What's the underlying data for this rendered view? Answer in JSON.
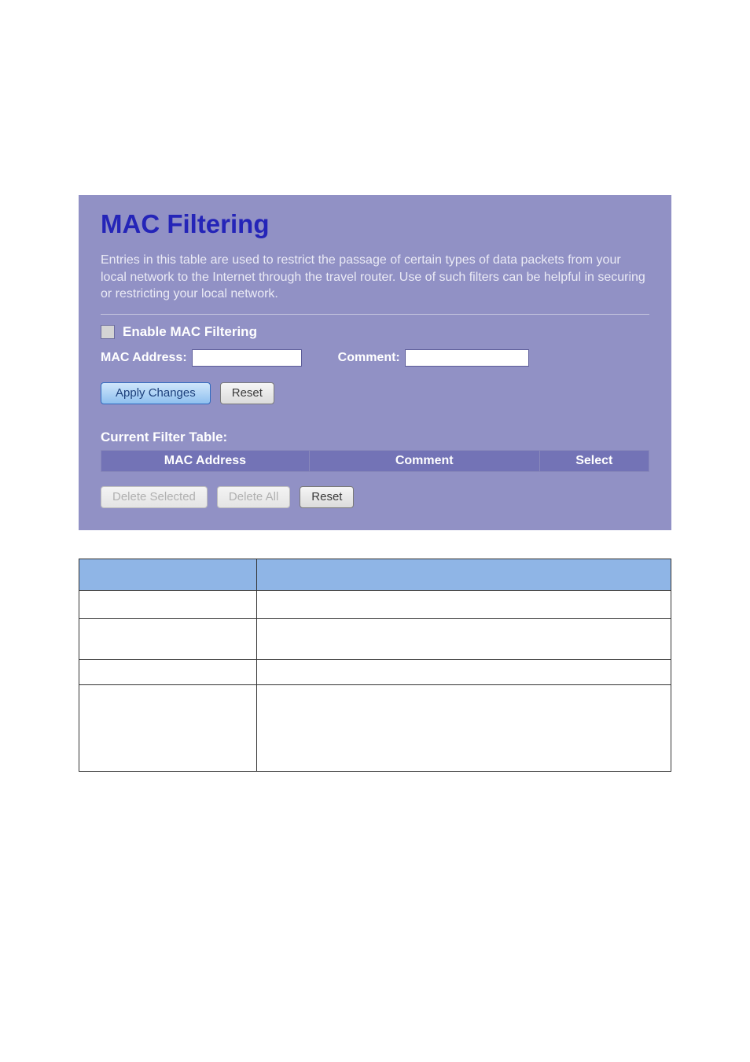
{
  "page": {
    "title": "MAC Filtering",
    "description": "Entries in this table are used to restrict the passage of certain types of data packets from your local network to the Internet through the travel router. Use of such filters can be helpful in securing or restricting your local network."
  },
  "form": {
    "enable_label": "Enable MAC Filtering",
    "enable_checked": false,
    "mac_label": "MAC Address:",
    "mac_value": "",
    "comment_label": "Comment:",
    "comment_value": "",
    "apply_label": "Apply Changes",
    "reset_label": "Reset"
  },
  "filter_table": {
    "title": "Current Filter Table:",
    "headers": {
      "mac": "MAC Address",
      "comment": "Comment",
      "select": "Select"
    }
  },
  "actions": {
    "delete_selected": "Delete Selected",
    "delete_all": "Delete All",
    "reset": "Reset"
  }
}
